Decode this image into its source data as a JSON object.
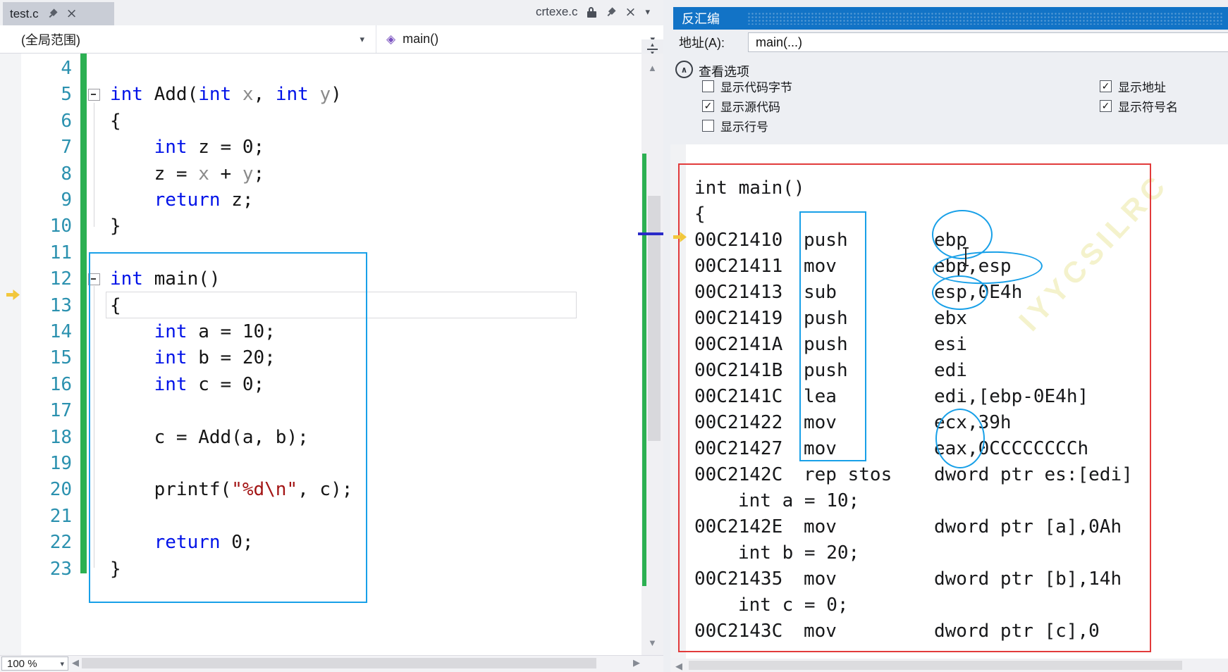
{
  "tabs": {
    "left_tab": "test.c",
    "right_tab": "crtexe.c"
  },
  "navbar": {
    "scope": "(全局范围)",
    "function": "main()"
  },
  "icons": {
    "chevron_down": "▾",
    "close": "×",
    "collapse": "∧",
    "method": "◈",
    "check": "✓",
    "left_arrow": "◀",
    "right_arrow": "▶",
    "up_arrow": "▲",
    "down_arrow": "▼"
  },
  "statusbar": {
    "zoom": "100 %"
  },
  "editor": {
    "lines": [
      {
        "n": 4,
        "tokens": []
      },
      {
        "n": 5,
        "fold": true,
        "tokens": [
          {
            "c": "k",
            "t": "int"
          },
          {
            "c": "p",
            "t": " Add("
          },
          {
            "c": "k",
            "t": "int"
          },
          {
            "c": "p",
            "t": " "
          },
          {
            "c": "g",
            "t": "x"
          },
          {
            "c": "p",
            "t": ", "
          },
          {
            "c": "k",
            "t": "int"
          },
          {
            "c": "p",
            "t": " "
          },
          {
            "c": "g",
            "t": "y"
          },
          {
            "c": "p",
            "t": ")"
          }
        ]
      },
      {
        "n": 6,
        "tokens": [
          {
            "c": "p",
            "t": "{"
          }
        ]
      },
      {
        "n": 7,
        "tokens": [
          {
            "c": "p",
            "t": "    "
          },
          {
            "c": "k",
            "t": "int"
          },
          {
            "c": "p",
            "t": " z = 0;"
          }
        ]
      },
      {
        "n": 8,
        "tokens": [
          {
            "c": "p",
            "t": "    z = "
          },
          {
            "c": "g",
            "t": "x"
          },
          {
            "c": "p",
            "t": " + "
          },
          {
            "c": "g",
            "t": "y"
          },
          {
            "c": "p",
            "t": ";"
          }
        ]
      },
      {
        "n": 9,
        "tokens": [
          {
            "c": "p",
            "t": "    "
          },
          {
            "c": "k",
            "t": "return"
          },
          {
            "c": "p",
            "t": " z;"
          }
        ]
      },
      {
        "n": 10,
        "tokens": [
          {
            "c": "p",
            "t": "}"
          }
        ]
      },
      {
        "n": 11,
        "tokens": []
      },
      {
        "n": 12,
        "fold": true,
        "tokens": [
          {
            "c": "k",
            "t": "int"
          },
          {
            "c": "p",
            "t": " main()"
          }
        ]
      },
      {
        "n": 13,
        "tokens": [
          {
            "c": "p",
            "t": "{"
          }
        ]
      },
      {
        "n": 14,
        "tokens": [
          {
            "c": "p",
            "t": "    "
          },
          {
            "c": "k",
            "t": "int"
          },
          {
            "c": "p",
            "t": " a = 10;"
          }
        ]
      },
      {
        "n": 15,
        "tokens": [
          {
            "c": "p",
            "t": "    "
          },
          {
            "c": "k",
            "t": "int"
          },
          {
            "c": "p",
            "t": " b = 20;"
          }
        ]
      },
      {
        "n": 16,
        "tokens": [
          {
            "c": "p",
            "t": "    "
          },
          {
            "c": "k",
            "t": "int"
          },
          {
            "c": "p",
            "t": " c = 0;"
          }
        ]
      },
      {
        "n": 17,
        "tokens": []
      },
      {
        "n": 18,
        "tokens": [
          {
            "c": "p",
            "t": "    c = Add(a, b);"
          }
        ]
      },
      {
        "n": 19,
        "tokens": []
      },
      {
        "n": 20,
        "tokens": [
          {
            "c": "p",
            "t": "    printf("
          },
          {
            "c": "s",
            "t": "\"%d\\n\""
          },
          {
            "c": "p",
            "t": ", c);"
          }
        ]
      },
      {
        "n": 21,
        "tokens": []
      },
      {
        "n": 22,
        "tokens": [
          {
            "c": "p",
            "t": "    "
          },
          {
            "c": "k",
            "t": "return"
          },
          {
            "c": "p",
            "t": " 0;"
          }
        ]
      },
      {
        "n": 23,
        "tokens": [
          {
            "c": "p",
            "t": "}"
          }
        ]
      }
    ]
  },
  "disasm_panel": {
    "title": "反汇编",
    "address_label": "地址(A):",
    "address_value": "main(...)",
    "options_header": "查看选项",
    "options_left": [
      {
        "label": "显示代码字节",
        "checked": false
      },
      {
        "label": "显示源代码",
        "checked": true
      },
      {
        "label": "显示行号",
        "checked": false
      }
    ],
    "options_right": [
      {
        "label": "显示地址",
        "checked": true
      },
      {
        "label": "显示符号名",
        "checked": true
      }
    ],
    "watermark": "IYYCSILRC",
    "lines": [
      {
        "t": "sym",
        "text": "int main()"
      },
      {
        "t": "sym",
        "text": "{"
      },
      {
        "t": "ins",
        "addr": "00C21410",
        "mn": "push",
        "ops": "ebp"
      },
      {
        "t": "ins",
        "addr": "00C21411",
        "mn": "mov",
        "ops": "ebp,esp"
      },
      {
        "t": "ins",
        "addr": "00C21413",
        "mn": "sub",
        "ops": "esp,0E4h"
      },
      {
        "t": "ins",
        "addr": "00C21419",
        "mn": "push",
        "ops": "ebx"
      },
      {
        "t": "ins",
        "addr": "00C2141A",
        "mn": "push",
        "ops": "esi"
      },
      {
        "t": "ins",
        "addr": "00C2141B",
        "mn": "push",
        "ops": "edi"
      },
      {
        "t": "ins",
        "addr": "00C2141C",
        "mn": "lea",
        "ops": "edi,[ebp-0E4h]"
      },
      {
        "t": "ins",
        "addr": "00C21422",
        "mn": "mov",
        "ops": "ecx,39h"
      },
      {
        "t": "ins",
        "addr": "00C21427",
        "mn": "mov",
        "ops": "eax,0CCCCCCCCh"
      },
      {
        "t": "ins",
        "addr": "00C2142C",
        "mn": "rep stos",
        "ops": "dword ptr es:[edi]"
      },
      {
        "t": "src",
        "text": "int a = 10;"
      },
      {
        "t": "ins",
        "addr": "00C2142E",
        "mn": "mov",
        "ops": "dword ptr [a],0Ah"
      },
      {
        "t": "src",
        "text": "int b = 20;"
      },
      {
        "t": "ins",
        "addr": "00C21435",
        "mn": "mov",
        "ops": "dword ptr [b],14h"
      },
      {
        "t": "src",
        "text": "int c = 0;"
      },
      {
        "t": "ins",
        "addr": "00C2143C",
        "mn": "mov",
        "ops": "dword ptr [c],0"
      }
    ]
  },
  "colors": {
    "title_bar_blue": "#1273c6",
    "annotation_blue": "#18a0e8",
    "annotation_red": "#e23b3b",
    "change_track_green": "#2cb052",
    "keyword_blue": "#0012e8",
    "string_red": "#a31515",
    "line_number_teal": "#2b91af",
    "ip_arrow_yellow": "#f2c73c"
  }
}
